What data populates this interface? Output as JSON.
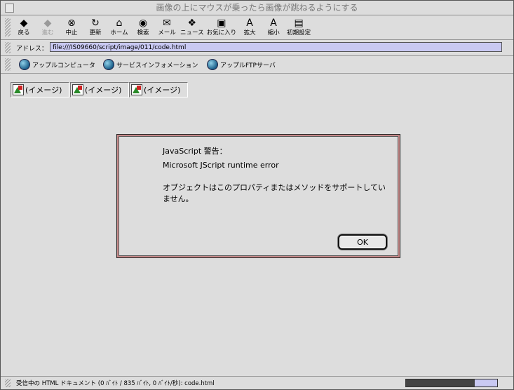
{
  "window": {
    "title": "画像の上にマウスが乗ったら画像が跳ねるようにする"
  },
  "toolbar": {
    "buttons": [
      {
        "label": "戻る",
        "glyph": "◆",
        "enabled": true
      },
      {
        "label": "進む",
        "glyph": "◆",
        "enabled": false
      },
      {
        "label": "中止",
        "glyph": "⊗",
        "enabled": true
      },
      {
        "label": "更新",
        "glyph": "↻",
        "enabled": true
      },
      {
        "label": "ホーム",
        "glyph": "⌂",
        "enabled": true
      },
      {
        "label": "検索",
        "glyph": "◉",
        "enabled": true
      },
      {
        "label": "メール",
        "glyph": "✉",
        "enabled": true
      },
      {
        "label": "ニュース",
        "glyph": "❖",
        "enabled": true
      },
      {
        "label": "お気に入り",
        "glyph": "▣",
        "enabled": true
      },
      {
        "label": "拡大",
        "glyph": "A",
        "enabled": true
      },
      {
        "label": "縮小",
        "glyph": "A",
        "enabled": true
      },
      {
        "label": "初期設定",
        "glyph": "▤",
        "enabled": true
      }
    ]
  },
  "address": {
    "label": "アドレス：",
    "url": "file:///IS09660/script/image/011/code.html"
  },
  "links": {
    "items": [
      {
        "label": "アップルコンピュータ"
      },
      {
        "label": "サービスインフォメーション"
      },
      {
        "label": "アップルFTPサーバ"
      }
    ]
  },
  "content": {
    "images": [
      {
        "alt": "(イメージ)"
      },
      {
        "alt": "(イメージ)"
      },
      {
        "alt": "(イメージ)"
      }
    ]
  },
  "dialog": {
    "title": "JavaScript 警告：",
    "message1": "Microsoft JScript runtime error",
    "message2": "オブジェクトはこのプロパティまたはメソッドをサポートしていません。",
    "ok_label": "OK"
  },
  "status": {
    "text": "受信中の HTML ドキュメント (0 ﾊﾞｲﾄ / 835 ﾊﾞｲﾄ, 0 ﾊﾞｲﾄ/秒): code.html",
    "progress": 0.75
  }
}
